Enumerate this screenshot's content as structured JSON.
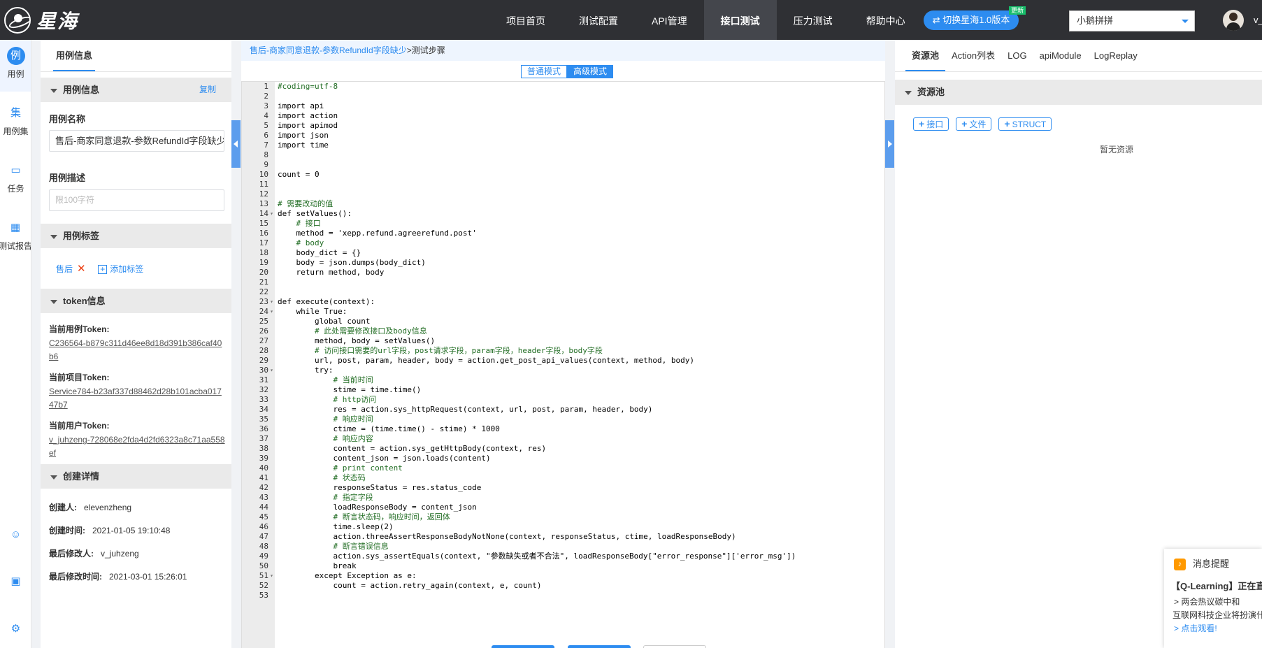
{
  "app": {
    "logo_text": "星海"
  },
  "nav": {
    "items": [
      "项目首页",
      "测试配置",
      "API管理",
      "接口测试",
      "压力测试",
      "帮助中心"
    ],
    "active_index": 3,
    "switch_label": "⇄ 切换星海1.0版本",
    "switch_badge": "更新",
    "project_selected": "小鹅拼拼",
    "user": "v_"
  },
  "rail": [
    {
      "icon": "例",
      "label": "用例"
    },
    {
      "icon": "集",
      "label": "用例集"
    },
    {
      "icon": "▭",
      "label": "任务"
    },
    {
      "icon": "▦",
      "label": "测试报告"
    }
  ],
  "left": {
    "tab": "用例信息",
    "sec_case": "用例信息",
    "copy": "复制",
    "name_label": "用例名称",
    "name_value": "售后-商家同意退款-参数RefundId字段缺少",
    "desc_label": "用例描述",
    "desc_placeholder": "限100字符",
    "sec_tags": "用例标签",
    "tag": "售后",
    "add_tag": "添加标签",
    "sec_token": "token信息",
    "tokens": [
      {
        "label": "当前用例Token:",
        "value": "C236564-b879c311d46ee8d18d391b386caf40b6"
      },
      {
        "label": "当前项目Token:",
        "value": "Service784-b23af337d88462d28b101acba01747b7"
      },
      {
        "label": "当前用户Token:",
        "value": "v_juhzeng-728068e2fda4d2fd6323a8c71aa558ef"
      }
    ],
    "sec_create": "创建详情",
    "meta": [
      {
        "label": "创建人:",
        "value": "elevenzheng"
      },
      {
        "label": "创建时间:",
        "value": "2021-01-05 19:10:48"
      },
      {
        "label": "最后修改人:",
        "value": "v_juhzeng"
      },
      {
        "label": "最后修改时间:",
        "value": "2021-03-01 15:26:01"
      }
    ]
  },
  "center": {
    "crumb_link": "售后-商家同意退款-参数RefundId字段缺少",
    "crumb_rest": ">测试步骤",
    "mode_normal": "普通模式",
    "mode_advanced": "高级模式",
    "code": [
      "#coding=utf-8",
      "",
      "import api",
      "import action",
      "import apimod",
      "import json",
      "import time",
      "",
      "",
      "count = 0",
      "",
      "",
      "# 需要改动的值",
      "def setValues():",
      "    # 接口",
      "    method = 'xepp.refund.agreerefund.post'",
      "    # body",
      "    body_dict = {}",
      "    body = json.dumps(body_dict)",
      "    return method, body",
      "",
      "",
      "def execute(context):",
      "    while True:",
      "        global count",
      "        # 此处需要修改接口及body信息",
      "        method, body = setValues()",
      "        # 访问接口需要的url字段，post请求字段，param字段，header字段，body字段",
      "        url, post, param, header, body = action.get_post_api_values(context, method, body)",
      "        try:",
      "            # 当前时间",
      "            stime = time.time()",
      "            # http访问",
      "            res = action.sys_httpRequest(context, url, post, param, header, body)",
      "            # 响应时间",
      "            ctime = (time.time() - stime) * 1000",
      "            # 响应内容",
      "            content = action.sys_getHttpBody(context, res)",
      "            content_json = json.loads(content)",
      "            # print content",
      "            # 状态码",
      "            responseStatus = res.status_code",
      "            # 指定字段",
      "            loadResponseBody = content_json",
      "            # 断言状态码，响应时间，返回体",
      "            time.sleep(2)",
      "            action.threeAssertResponseBodyNotNone(context, responseStatus, ctime, loadResponseBody)",
      "            # 断言错误信息",
      "            action.sys_assertEquals(context, \"参数缺失或者不合法\", loadResponseBody[\"error_response\"]['error_msg'])",
      "            break",
      "        except Exception as e:",
      "            count = action.retry_again(context, e, count)",
      ""
    ],
    "fold_lines": [
      14,
      23,
      24,
      30,
      51
    ]
  },
  "right": {
    "tabs": [
      "资源池",
      "Action列表",
      "LOG",
      "apiModule",
      "LogReplay"
    ],
    "sec": "资源池",
    "btns": [
      "接口",
      "文件",
      "STRUCT"
    ],
    "empty": "暂无资源"
  },
  "notice": {
    "head": "消息提醒",
    "title": "【Q-Learning】正在直",
    "line1": "> 两会热议碳中和",
    "line2": "互联网科技企业将扮演什",
    "link": "> 点击观看!"
  },
  "colors": {
    "accent": "#2d8cf0",
    "topbar": "#2f3034",
    "comment": "#236e25",
    "keyword": "#0000ff"
  }
}
